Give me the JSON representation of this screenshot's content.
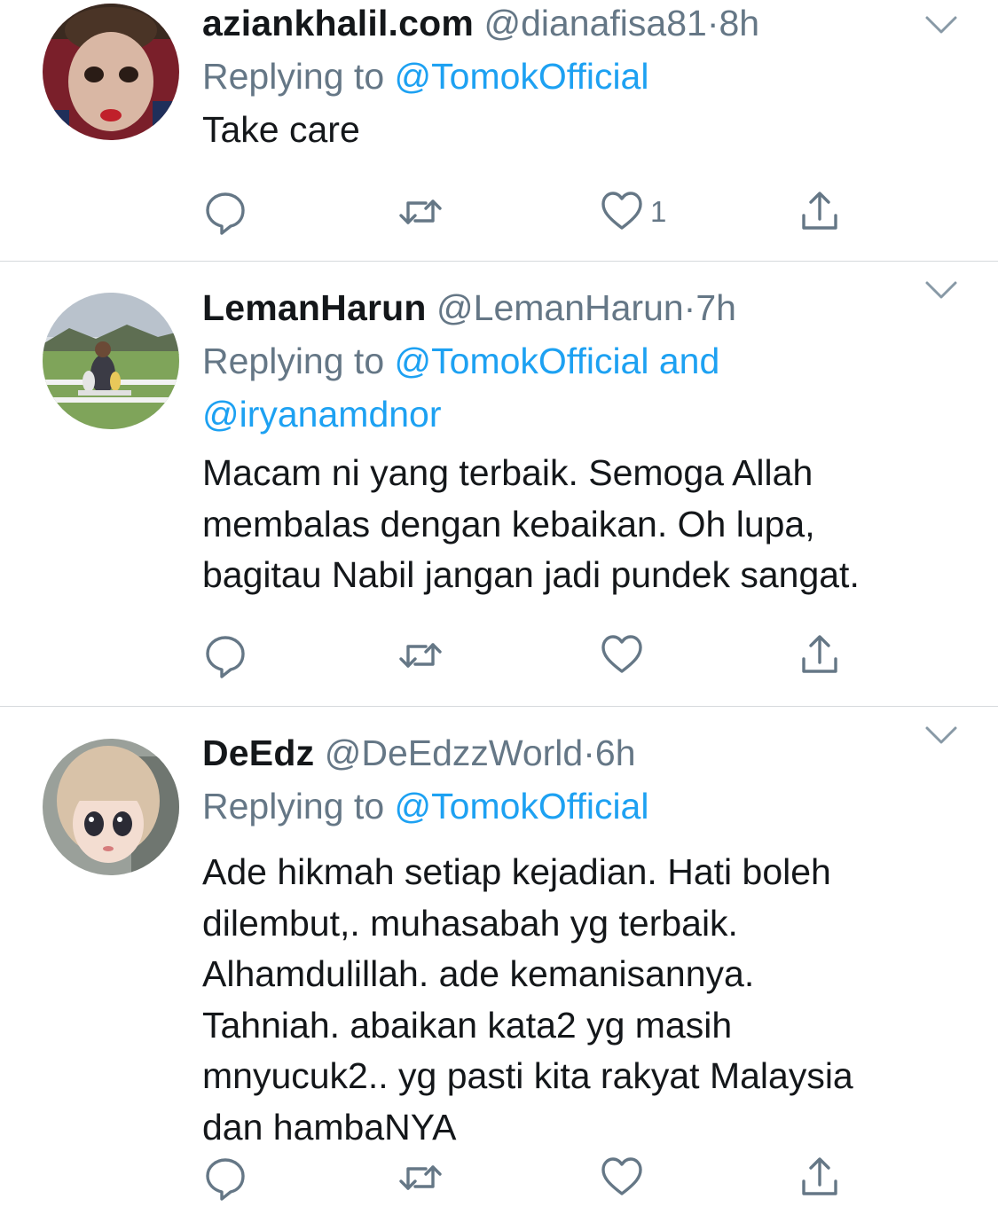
{
  "colors": {
    "name": "#14171a",
    "secondary": "#657786",
    "link": "#1da1f2",
    "divider": "#d6d9dc",
    "icon": "#657786"
  },
  "icons": {
    "reply": "reply-icon",
    "retweet": "retweet-icon",
    "like": "heart-icon",
    "share": "share-icon",
    "menu": "chevron-down-icon"
  },
  "tweets": [
    {
      "display_name": "aziankhalil.com",
      "handle": "@dianafisa81",
      "separator": "·",
      "time": "8h",
      "replying_prefix": "Replying to",
      "replying_to": "@TomokOfficial",
      "body": [
        "Take care"
      ],
      "like_count": "1"
    },
    {
      "display_name": "LemanHarun",
      "handle": "@LemanHarun",
      "separator": "·",
      "time": "7h",
      "replying_prefix": "Replying to",
      "replying_to": "@TomokOfficial and",
      "replying_to_2": "@iryanamdnor",
      "body": [
        "Macam ni yang terbaik. Semoga Allah",
        "membalas dengan kebaikan. Oh lupa,",
        "bagitau Nabil jangan jadi pundek sangat."
      ],
      "like_count": ""
    },
    {
      "display_name": "DeEdz",
      "handle": "@DeEdzzWorld",
      "separator": "·",
      "time": "6h",
      "replying_prefix": "Replying to",
      "replying_to": "@TomokOfficial",
      "body": [
        "Ade hikmah setiap kejadian.  Hati boleh",
        "dilembut,. muhasabah yg terbaik.",
        "Alhamdulillah.  ade kemanisannya.",
        "Tahniah. abaikan kata2 yg masih",
        "mnyucuk2.. yg pasti kita rakyat Malaysia",
        "dan hambaNYA"
      ],
      "like_count": ""
    }
  ]
}
